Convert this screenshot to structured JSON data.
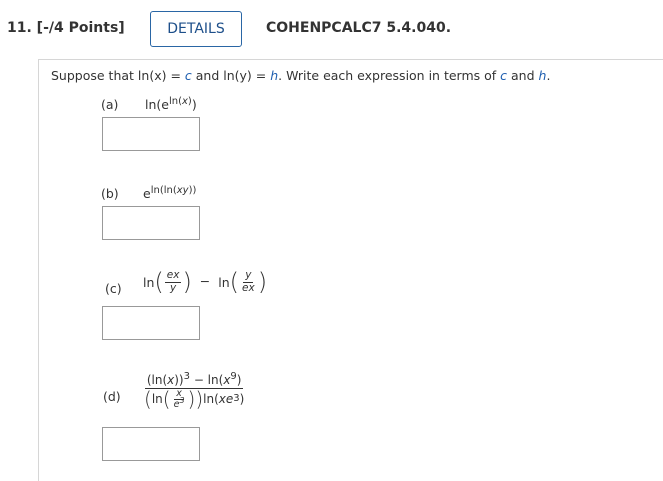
{
  "header": {
    "question_number": "11.  [-/4 Points]",
    "details_label": "DETAILS",
    "problem_code": "COHENPCALC7 5.4.040."
  },
  "prompt": {
    "t1": "Suppose that ",
    "t2": "ln(x) = ",
    "c1": "c",
    "t3": " and ln(y) = ",
    "h1": "h",
    "t4": ". Write each expression in terms of ",
    "c2": "c",
    "t5": " and ",
    "h2": "h",
    "t6": "."
  },
  "parts": {
    "a": {
      "label": "(a)",
      "answer": ""
    },
    "b": {
      "label": "(b)",
      "answer": ""
    },
    "c": {
      "label": "(c)",
      "answer": ""
    },
    "d": {
      "label": "(d)",
      "answer": ""
    }
  }
}
